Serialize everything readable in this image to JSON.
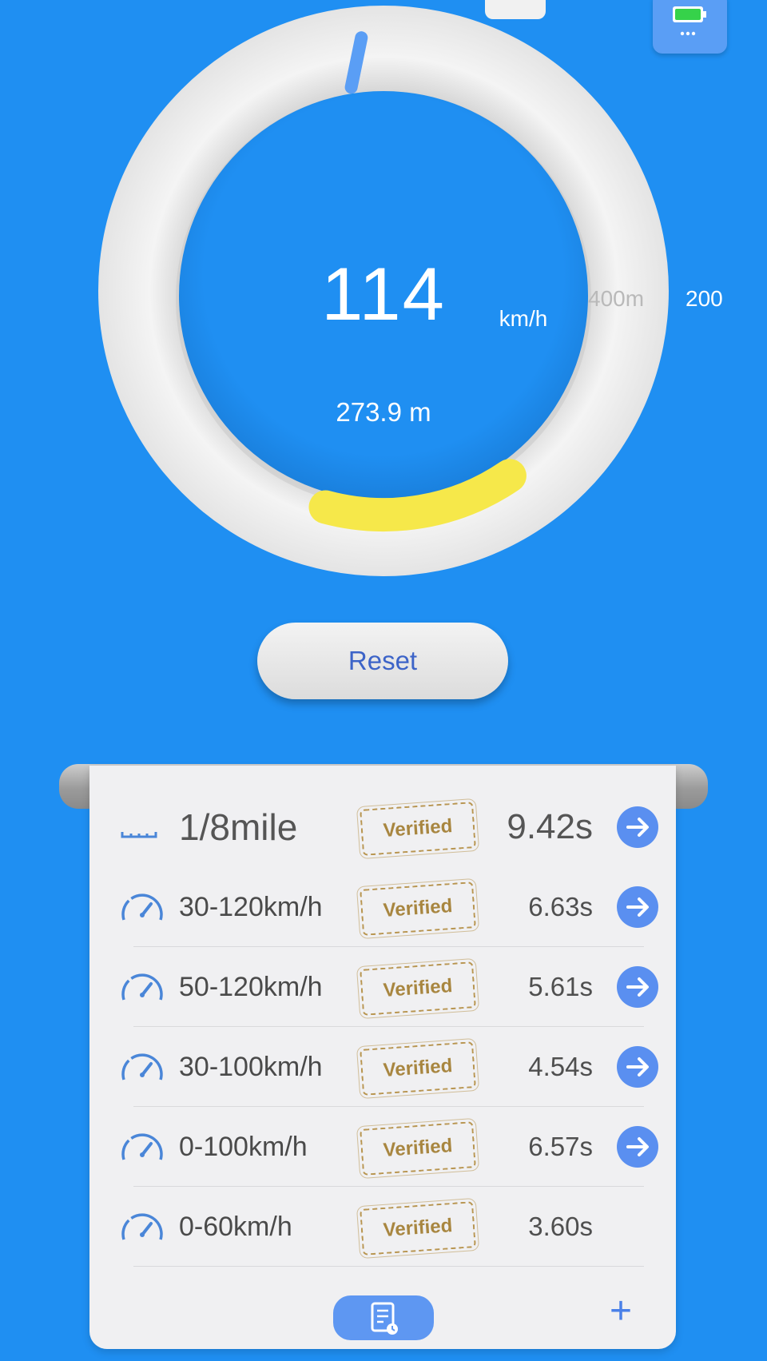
{
  "gauge": {
    "speed": "114",
    "speed_unit": "km/h",
    "distance": "273.9 m",
    "target_label": "400m",
    "scale_label": "200",
    "progress_fraction": 0.685,
    "colors": {
      "background": "#1f8ff2",
      "ring": "#eeeeee",
      "progress": "#f6e84a",
      "needle": "#5a9ef5"
    }
  },
  "controls": {
    "reset_label": "Reset"
  },
  "results": {
    "stamp_label": "Verified",
    "rows": [
      {
        "icon": "ruler-icon",
        "label": "1/8mile",
        "time": "9.42s",
        "has_arrow": true
      },
      {
        "icon": "speedometer-icon",
        "label": "30-120km/h",
        "time": "6.63s",
        "has_arrow": true
      },
      {
        "icon": "speedometer-icon",
        "label": "50-120km/h",
        "time": "5.61s",
        "has_arrow": true
      },
      {
        "icon": "speedometer-icon",
        "label": "30-100km/h",
        "time": "4.54s",
        "has_arrow": true
      },
      {
        "icon": "speedometer-icon",
        "label": "0-100km/h",
        "time": "6.57s",
        "has_arrow": true
      },
      {
        "icon": "speedometer-icon",
        "label": "0-60km/h",
        "time": "3.60s",
        "has_arrow": false
      }
    ],
    "footer": {
      "record_icon": "record-list-icon",
      "add_label": "+"
    }
  }
}
